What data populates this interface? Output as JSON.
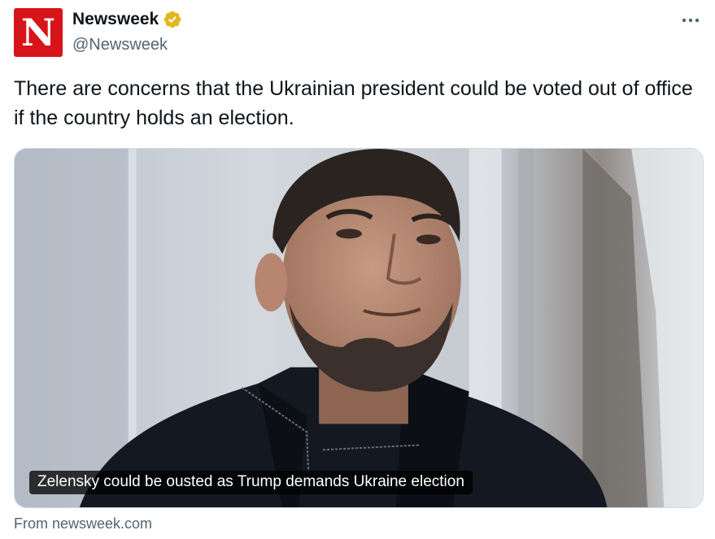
{
  "account": {
    "avatar_letter": "N",
    "display_name": "Newsweek",
    "handle": "@Newsweek",
    "verified": true,
    "brand_color": "#d7141a",
    "verified_color": "#e2b719"
  },
  "more_menu": {
    "icon": "more-horizontal-icon"
  },
  "tweet": {
    "text": "There are concerns that the Ukrainian president could be voted out of office if the country holds an election."
  },
  "card": {
    "caption": "Zelensky could be ousted as Trump demands Ukraine election",
    "source": "From newsweek.com"
  }
}
